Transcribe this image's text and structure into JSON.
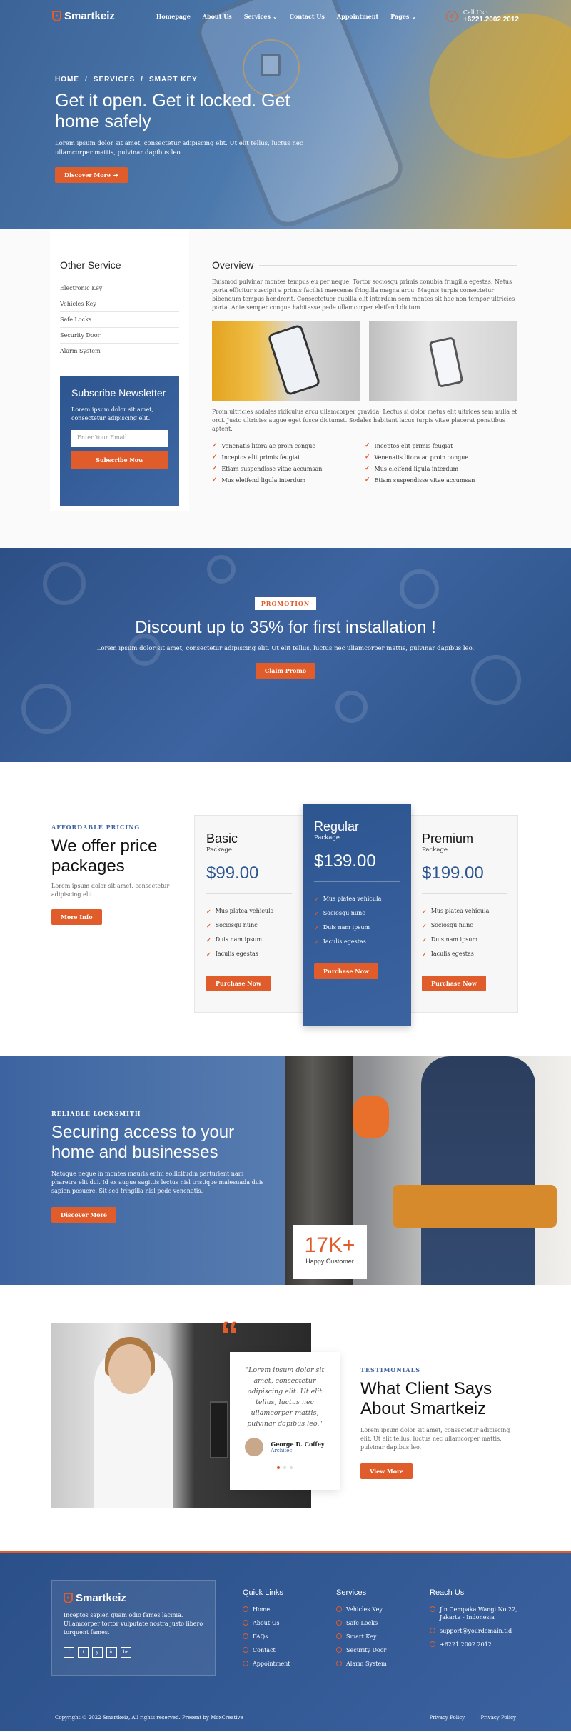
{
  "brand": "Smartkeiz",
  "nav": [
    {
      "label": "Homepage",
      "caret": false
    },
    {
      "label": "About Us",
      "caret": false
    },
    {
      "label": "Services",
      "caret": true
    },
    {
      "label": "Contact Us",
      "caret": false
    },
    {
      "label": "Appointment",
      "caret": false
    },
    {
      "label": "Pages",
      "caret": true
    }
  ],
  "call": {
    "label": "Call Us :",
    "number": "+6221.2002.2012"
  },
  "hero": {
    "crumbs": [
      "HOME",
      "/",
      "SERVICES",
      "/",
      "SMART KEY"
    ],
    "title": "Get it open. Get it locked. Get home safely",
    "text": "Lorem ipsum dolor sit amet, consectetur adipiscing elit. Ut elit tellus, luctus nec ullamcorper mattis, pulvinar dapibus leo.",
    "button": "Discover More"
  },
  "sidebar": {
    "title": "Other Service",
    "items": [
      "Electronic Key",
      "Vehicles Key",
      "Safe Locks",
      "Security Door",
      "Alarm System"
    ],
    "subscribe": {
      "title": "Subscribe Newsletter",
      "text": "Lorem ipsum dolor sit amet, consectetur adipiscing elit.",
      "placeholder": "Enter Your Email",
      "button": "Subscribe Now"
    }
  },
  "overview": {
    "title": "Overview",
    "p1": "Euismod pulvinar montes tempus eu per neque. Tortor sociosqu primis conubia fringilla egestas. Netus porta efficitur suscipit a primis facilisi maecenas fringilla magna arcu. Magnis turpis consectetur bibendum tempus hendrerit. Consectetuer cubilia elit interdum sem montes sit hac non tempor ultricies porta. Ante semper congue habitasse pede ullamcorper eleifend dictum.",
    "p2": "Proin ultricies sodales ridiculus arcu ullamcorper gravida. Lectus si dolor metus elit ultrices sem nulla et orci. Justo ultricies augue eget fusce dictumst. Sodales habitant lacus turpis vitae placerat penatibus aptent.",
    "checks": [
      "Venenatis litora ac proin congue",
      "Inceptos elit primis feugiat",
      "Inceptos elit primis feugiat",
      "Venenatis litora ac proin congue",
      "Etiam suspendisse vitae accumsan",
      "Mus eleifend ligula interdum",
      "Mus eleifend ligula interdum",
      "Etiam suspendisse vitae accumsan"
    ]
  },
  "promo": {
    "tag": "PROMOTION",
    "title": "Discount up to 35% for first installation !",
    "text": "Lorem ipsum dolor sit amet, consectetur adipiscing elit. Ut elit tellus, luctus nec ullamcorper mattis, pulvinar dapibus leo.",
    "button": "Claim Promo"
  },
  "pricing": {
    "eyebrow": "AFFORDABLE PRICING",
    "title": "We offer price packages",
    "text": "Lorem ipsum dolor sit amet, consectetur adipiscing elit.",
    "button": "More Info",
    "plans": [
      {
        "name": "Basic",
        "sub": "Package",
        "price": "$99.00",
        "features": [
          "Mus platea vehicula",
          "Sociosqu nunc",
          "Duis nam ipsum",
          "Iaculis egestas"
        ],
        "button": "Purchase Now"
      },
      {
        "name": "Regular",
        "sub": "Package",
        "price": "$139.00",
        "features": [
          "Mus platea vehicula",
          "Sociosqu nunc",
          "Duis nam ipsum",
          "Iaculis egestas"
        ],
        "button": "Purchase Now"
      },
      {
        "name": "Premium",
        "sub": "Package",
        "price": "$199.00",
        "features": [
          "Mus platea vehicula",
          "Sociosqu nunc",
          "Duis nam ipsum",
          "Iaculis egestas"
        ],
        "button": "Purchase Now"
      }
    ]
  },
  "locksmith": {
    "eyebrow": "RELIABLE LOCKSMITH",
    "title": "Securing access to your home and businesses",
    "text": "Natoque neque in montes mauris enim sollicitudin parturient nam pharetra elit dui. Id ex augue sagittis lectus nisl tristique malesuada duis sapien posuere. Sit sed fringilla nisl pede venenatis.",
    "button": "Discover More",
    "stat": "17K+",
    "stat_label": "Happy Customer"
  },
  "testimonial": {
    "quote": "\"Lorem ipsum dolor sit amet, consectetur adipiscing elit. Ut elit tellus, luctus nec ullamcorper mattis, pulvinar dapibus leo.\"",
    "name": "George D. Coffey",
    "role": "Architec",
    "eyebrow": "TESTIMONIALS",
    "title": "What Client Says About Smartkeiz",
    "text": "Lorem ipsum dolor sit amet, consectetur adipiscing elit. Ut elit tellus, luctus nec ullamcorper mattis, pulvinar dapibus leo.",
    "button": "View More"
  },
  "footer": {
    "text": "Inceptos sapien quam odio fames lacinia. Ullamcorper tortor vulputate nostra justo libero torquent fames.",
    "social": [
      "f",
      "t",
      "y",
      "in",
      "be"
    ],
    "quick": {
      "title": "Quick Links",
      "items": [
        "Home",
        "About Us",
        "FAQs",
        "Contact",
        "Appointment"
      ]
    },
    "services": {
      "title": "Services",
      "items": [
        "Vehicles Key",
        "Safe Locks",
        "Smart Key",
        "Security Door",
        "Alarm System"
      ]
    },
    "reach": {
      "title": "Reach Us",
      "items": [
        "Jln Cempaka Wangi No 22, Jakarta - Indonesia",
        "support@yourdomain.tld",
        "+6221.2002.2012"
      ]
    },
    "copyright": "Copyright © 2022 Smartkeiz, All rights reserved. Present by MoxCreative",
    "policies": [
      "Privacy Policy",
      "|",
      "Privacy Policy"
    ]
  }
}
